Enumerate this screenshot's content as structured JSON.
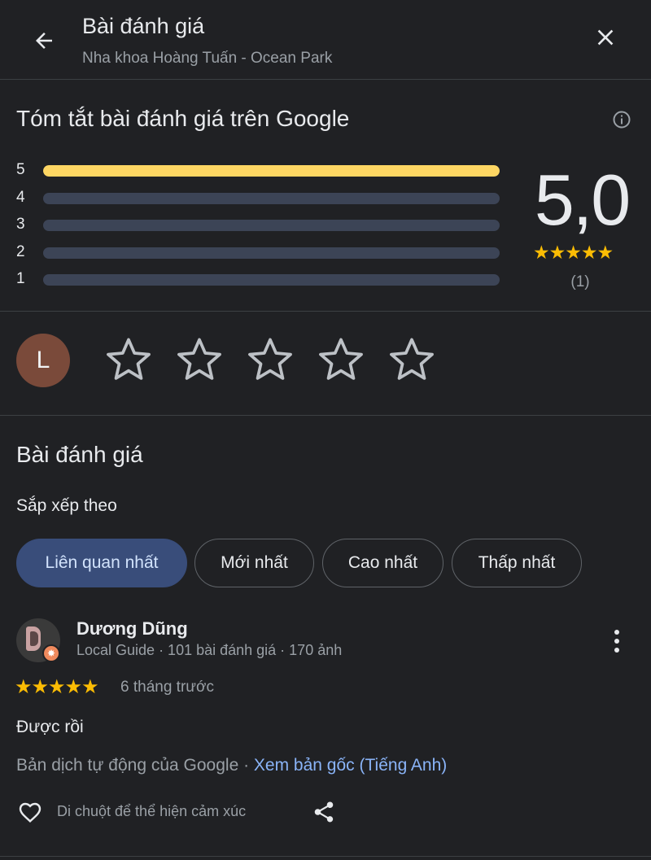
{
  "header": {
    "title": "Bài đánh giá",
    "subtitle": "Nha khoa Hoàng Tuấn - Ocean Park",
    "back_icon": "arrow-back-icon",
    "close_icon": "close-icon"
  },
  "summary": {
    "title": "Tóm tắt bài đánh giá trên Google",
    "info_icon": "info-icon",
    "distribution": [
      {
        "label": "5",
        "fraction": 1.0
      },
      {
        "label": "4",
        "fraction": 0.0
      },
      {
        "label": "3",
        "fraction": 0.0
      },
      {
        "label": "2",
        "fraction": 0.0
      },
      {
        "label": "1",
        "fraction": 0.0
      }
    ],
    "rating": "5,0",
    "stars": "★★★★★",
    "count": "(1)"
  },
  "rate": {
    "avatar_letter": "L",
    "star_count": 5
  },
  "reviews_section": {
    "title": "Bài đánh giá",
    "sort_label": "Sắp xếp theo",
    "sort_options": [
      {
        "label": "Liên quan nhất",
        "selected": true
      },
      {
        "label": "Mới nhất",
        "selected": false
      },
      {
        "label": "Cao nhất",
        "selected": false
      },
      {
        "label": "Thấp nhất",
        "selected": false
      }
    ]
  },
  "review": {
    "author": "Dương Dũng",
    "meta": "Local Guide · 101 bài đánh giá · 170 ảnh",
    "stars": "★★★★★",
    "rating": 5,
    "time": "6 tháng trước",
    "text": "Được rồi",
    "translation_note": "Bản dịch tự động của Google · ",
    "translation_link": "Xem bản gốc (Tiếng Anh)",
    "reaction_hint": "Di chuột để thể hiện cảm xúc"
  },
  "colors": {
    "background": "#202124",
    "accent_yellow": "#fdd663",
    "star_gold": "#fbbc04",
    "chip_active": "#394d7a",
    "link": "#8ab4f8"
  }
}
